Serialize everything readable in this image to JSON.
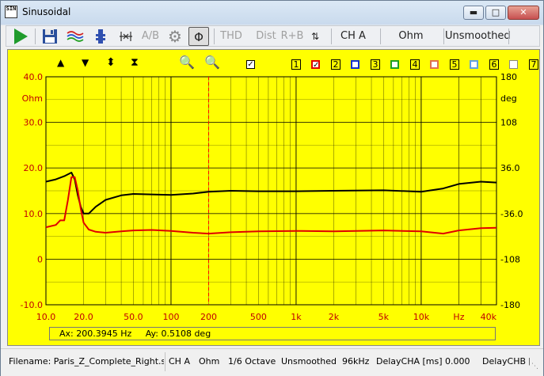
{
  "window": {
    "title": "Sinusoidal",
    "icon_text": "SIN"
  },
  "toolbar": {
    "ab_label": "A/B",
    "thd_label": "THD",
    "dist_label": "Dist",
    "rb_label": "R+B",
    "channel_label": "CH A",
    "unit_label": "Ohm",
    "smoothing_label": "Unsmoothed"
  },
  "colors": {
    "plot_bg": "#ffff00",
    "grid": "#000000",
    "trace_impedance": "#000000",
    "trace_phase": "#e00000",
    "axis_label": "#c00000",
    "cursor": "#ff0000"
  },
  "chart_data": {
    "type": "line",
    "x_scale": "log",
    "xlim": [
      10,
      40000
    ],
    "x_ticks": [
      "10.0",
      "20.0",
      "50.0",
      "100",
      "200",
      "500",
      "1k",
      "2k",
      "5k",
      "10k",
      "Hz",
      "40k"
    ],
    "y_left": {
      "label": "Ohm",
      "ylim": [
        -10,
        40
      ],
      "ticks": [
        "40.0",
        "30.0",
        "20.0",
        "10.0",
        "0",
        "-10.0"
      ]
    },
    "y_right": {
      "label": "deg",
      "ylim": [
        -180,
        180
      ],
      "ticks": [
        "180",
        "108",
        "36.0",
        "-36.0",
        "-108",
        "-180"
      ]
    },
    "grid": true,
    "series": [
      {
        "color": "#000000",
        "axis": "left",
        "x": [
          10,
          12,
          14,
          16,
          17,
          18,
          19,
          20,
          22,
          25,
          30,
          40,
          50,
          70,
          100,
          150,
          200,
          300,
          500,
          1000,
          2000,
          5000,
          10000,
          15000,
          20000,
          30000,
          40000
        ],
        "y": [
          17,
          17.5,
          18.2,
          19,
          17.5,
          14,
          11.5,
          10,
          10,
          11.5,
          13,
          14,
          14.3,
          14.2,
          14.1,
          14.4,
          14.8,
          15,
          14.9,
          14.9,
          15,
          15.1,
          14.8,
          15.5,
          16.5,
          17,
          16.8
        ]
      },
      {
        "color": "#e00000",
        "axis": "left",
        "x": [
          10,
          12,
          13,
          14,
          15,
          16,
          17,
          18,
          19,
          20,
          22,
          25,
          30,
          40,
          50,
          70,
          100,
          150,
          200,
          300,
          500,
          1000,
          2000,
          5000,
          10000,
          15000,
          20000,
          30000,
          40000
        ],
        "y": [
          7,
          7.5,
          8.5,
          8.5,
          13,
          18,
          18,
          15,
          11,
          8,
          6.5,
          6,
          5.8,
          6.1,
          6.3,
          6.4,
          6.2,
          5.8,
          5.6,
          5.9,
          6.1,
          6.2,
          6.1,
          6.3,
          6.1,
          5.6,
          6.3,
          6.8,
          6.9
        ]
      }
    ],
    "cursor_x": 200
  },
  "plot_controls": {
    "up_icon": "▲",
    "down_icon": "▼",
    "expand_icon": "⬍",
    "collapse_icon": "⧗",
    "channels": [
      "1",
      "2",
      "3",
      "4",
      "5",
      "6",
      "7"
    ]
  },
  "readout": {
    "ax": "Ax: 200.3945 Hz",
    "ay": "Ay: 0.5108 deg"
  },
  "statusbar": {
    "filename": "Filename: Paris_Z_Complete_Right.sin",
    "channel": "CH A",
    "unit": "Ohm",
    "octave": "1/6 Octave",
    "smoothing": "Unsmoothed",
    "rate": "96kHz",
    "delay_a": "DelayCHA [ms] 0.000",
    "delay_b": "DelayCHB [n"
  }
}
